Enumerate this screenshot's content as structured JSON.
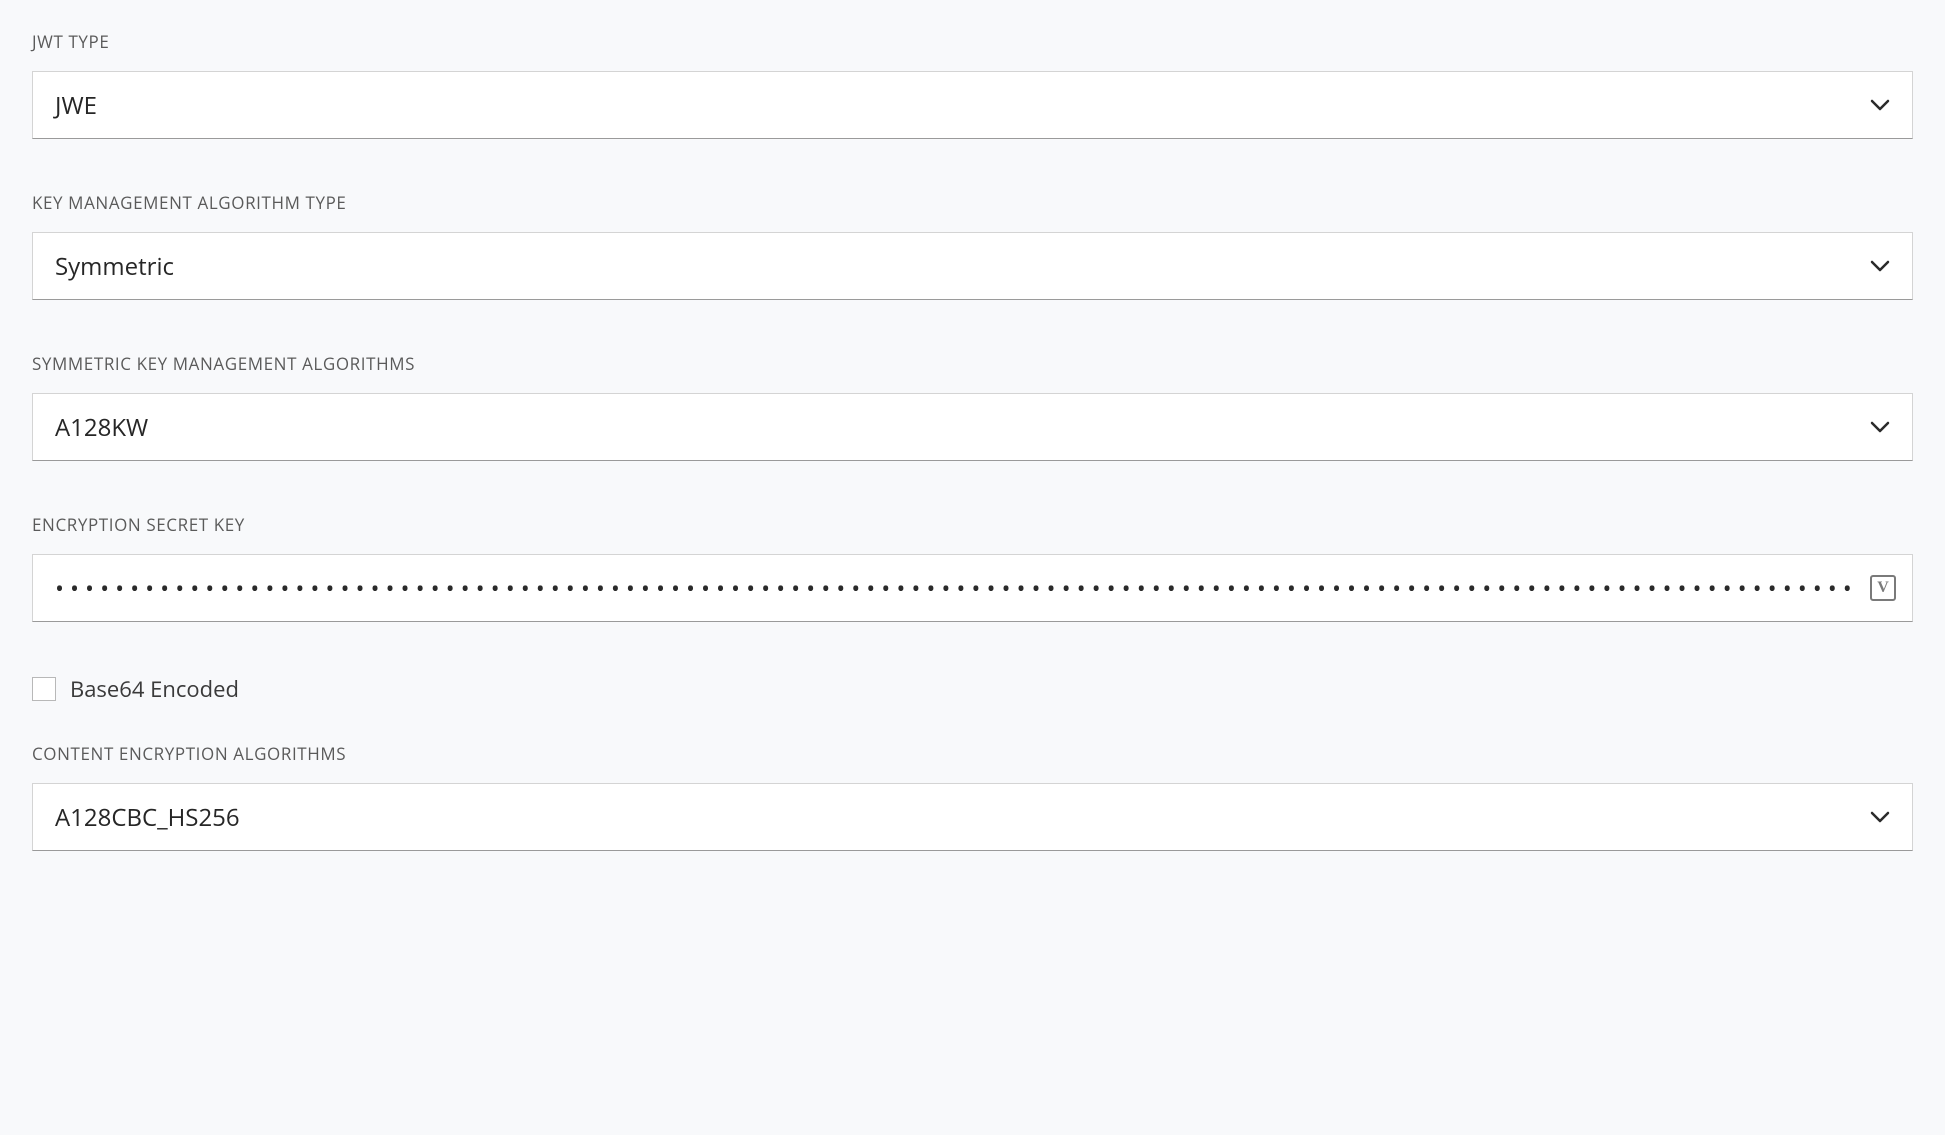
{
  "form": {
    "jwt_type": {
      "label": "JWT TYPE",
      "value": "JWE"
    },
    "key_mgmt_algo_type": {
      "label": "KEY MANAGEMENT ALGORITHM TYPE",
      "value": "Symmetric"
    },
    "symmetric_key_algos": {
      "label": "SYMMETRIC KEY MANAGEMENT ALGORITHMS",
      "value": "A128KW"
    },
    "encryption_secret": {
      "label": "ENCRYPTION SECRET KEY",
      "value": "•••••••••••••••••••••••••••••••••••••••••••••••••••••••••••••••••••••••••••••••••••••••••••••••••••••••••••••••••••••••••"
    },
    "base64_encoded": {
      "label": "Base64 Encoded",
      "checked": false
    },
    "content_encryption_algos": {
      "label": "CONTENT ENCRYPTION ALGORITHMS",
      "value": "A128CBC_HS256"
    }
  },
  "icons": {
    "vault_glyph": "V"
  }
}
